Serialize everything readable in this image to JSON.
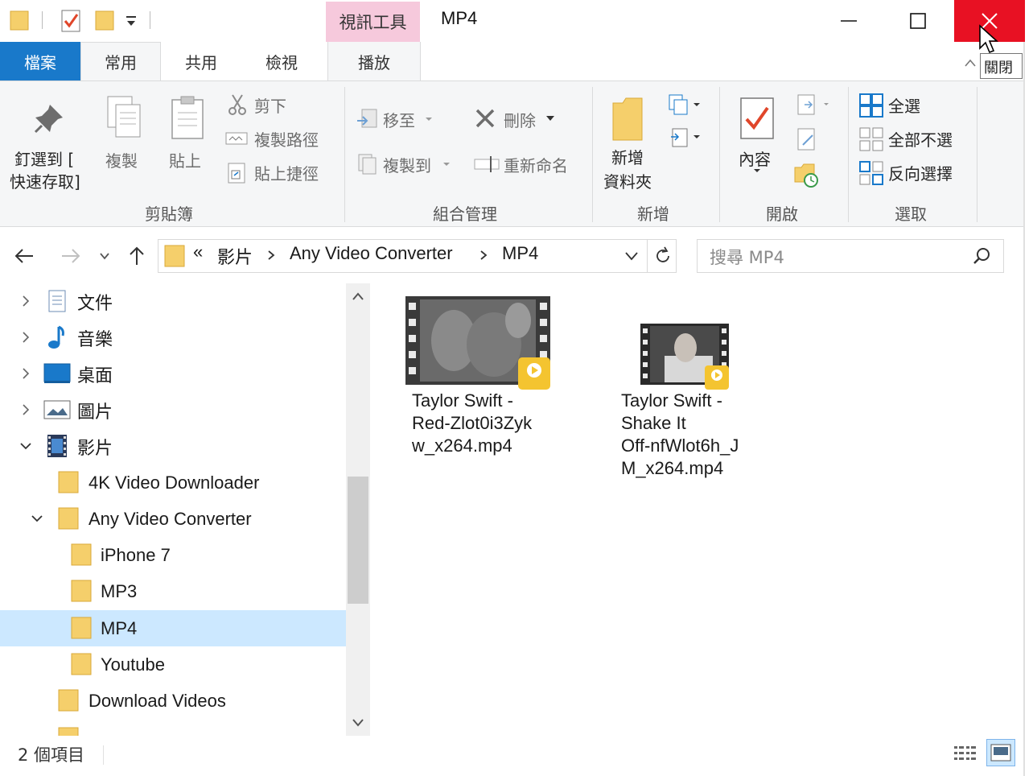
{
  "window": {
    "title": "MP4",
    "context_tab_group": "視訊工具",
    "close_tooltip": "關閉"
  },
  "ribbon": {
    "tabs": [
      "檔案",
      "常用",
      "共用",
      "檢視",
      "播放"
    ],
    "clipboard": {
      "pin_line1": "釘選到 [",
      "pin_line2": "快速存取]",
      "copy": "複製",
      "paste": "貼上",
      "cut": "剪下",
      "copy_path": "複製路徑",
      "paste_shortcut": "貼上捷徑",
      "group": "剪貼簿"
    },
    "organize": {
      "move_to": "移至",
      "copy_to": "複製到",
      "delete": "刪除",
      "rename": "重新命名",
      "group": "組合管理"
    },
    "new": {
      "new_folder_line1": "新增",
      "new_folder_line2": "資料夾",
      "group": "新增"
    },
    "open": {
      "properties": "內容",
      "group": "開啟"
    },
    "select": {
      "select_all": "全選",
      "select_none": "全部不選",
      "invert": "反向選擇",
      "group": "選取"
    }
  },
  "address": {
    "overflow": "«",
    "crumbs": [
      "影片",
      "Any Video Converter",
      "MP4"
    ],
    "search_placeholder": "搜尋 MP4"
  },
  "nav_tree": {
    "items": [
      {
        "label": "文件"
      },
      {
        "label": "音樂"
      },
      {
        "label": "桌面"
      },
      {
        "label": "圖片"
      },
      {
        "label": "影片"
      },
      {
        "label": "4K Video Downloader"
      },
      {
        "label": "Any Video Converter"
      },
      {
        "label": "iPhone 7"
      },
      {
        "label": "MP3"
      },
      {
        "label": "MP4"
      },
      {
        "label": "Youtube"
      },
      {
        "label": "Download Videos"
      }
    ]
  },
  "files": [
    {
      "line1": "Taylor Swift -",
      "line2": "Red-Zlot0i3Zyk",
      "line3": "w_x264.mp4",
      "line4": ""
    },
    {
      "line1": "Taylor Swift -",
      "line2": "Shake It",
      "line3": "Off-nfWlot6h_J",
      "line4": "M_x264.mp4"
    }
  ],
  "status": {
    "item_count": "2 個項目"
  },
  "colors": {
    "file_tab": "#1979ca",
    "close_button": "#e81123",
    "context_tab": "#f6c9dc",
    "selection": "#cce8ff",
    "folder": "#f5cf6b"
  }
}
